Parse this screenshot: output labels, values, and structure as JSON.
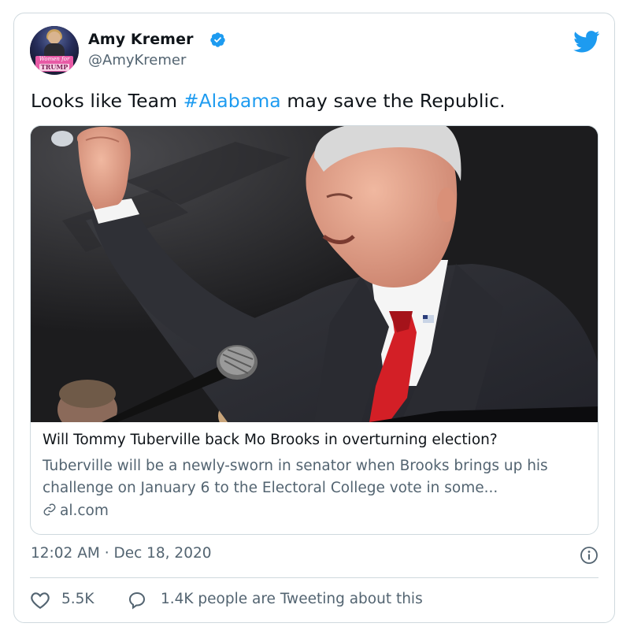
{
  "author": {
    "name": "Amy Kremer",
    "handle": "@AmyKremer",
    "avatar_sign_line1": "Women for",
    "avatar_sign_line2": "TRUMP"
  },
  "tweet": {
    "text_before": "Looks like Team ",
    "hashtag": "#Alabama",
    "text_after": " may save the Republic."
  },
  "link_card": {
    "title": "Will Tommy Tuberville back Mo Brooks in overturning election?",
    "description": "Tuberville will be a newly-sworn in senator when Brooks brings up his challenge on January 6 to the Electoral College vote in some...",
    "domain": "al.com"
  },
  "meta": {
    "timestamp": "12:02 AM · Dec 18, 2020"
  },
  "actions": {
    "like_count": "5.5K",
    "talk_text": "1.4K people are Tweeting about this"
  },
  "colors": {
    "accent": "#1d9bf0",
    "secondary_text": "#536471",
    "border": "#cfd9de",
    "tie": "#d31f26"
  },
  "icons": [
    "verified-badge-icon",
    "twitter-bird-icon",
    "link-icon",
    "info-icon",
    "heart-icon",
    "reply-bubble-icon"
  ]
}
